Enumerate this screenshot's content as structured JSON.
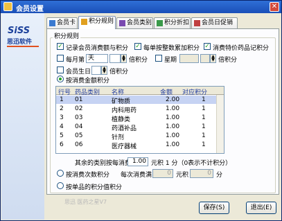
{
  "window": {
    "title": "会员设置",
    "close": "✕"
  },
  "logo": {
    "main": "SiSS",
    "sub": "思迅软件"
  },
  "tabs": [
    {
      "label": "会员卡"
    },
    {
      "label": "积分规则"
    },
    {
      "label": "会员类别"
    },
    {
      "label": "积分折扣"
    },
    {
      "label": "会员日促销"
    }
  ],
  "rules": {
    "group_label": "积分规则",
    "record_points": "记录会员消费额与积分",
    "whole_number": "每单按整数累加积分",
    "special_drug_points": "消费特价药品记积分",
    "monthly_prefix": "每月第",
    "monthly_unit": "天",
    "monthly_suffix": "倍积分",
    "weekly_prefix": "星期",
    "weekly_suffix": "倍积分",
    "birthday_prefix": "会员生日",
    "birthday_suffix": "倍积分",
    "by_amount": "按消费金额积分",
    "by_count": "按消费次数积分",
    "by_item": "按单品的积分值积分"
  },
  "grid": {
    "columns": [
      "行号",
      "药品类别",
      "名称",
      "金额",
      "对应积分"
    ],
    "rows": [
      {
        "no": "1",
        "code": "01",
        "name": "矿物质",
        "amount": "2.00",
        "points": "1"
      },
      {
        "no": "2",
        "code": "02",
        "name": "内科用药",
        "amount": "1.00",
        "points": "1"
      },
      {
        "no": "3",
        "code": "03",
        "name": "植静类",
        "amount": "1.00",
        "points": "1"
      },
      {
        "no": "4",
        "code": "04",
        "name": "药酒补品",
        "amount": "1.00",
        "points": "1"
      },
      {
        "no": "5",
        "code": "05",
        "name": "针剂",
        "amount": "1.00",
        "points": "1"
      },
      {
        "no": "6",
        "code": "06",
        "name": "医疗器械",
        "amount": "1.00",
        "points": "1"
      }
    ]
  },
  "other_category": {
    "label": "其余的类别按每消费",
    "value": "1.00",
    "unit_text": "元积 1 分（0表示不计积分）"
  },
  "count_rule": {
    "label": "每次消费满",
    "value": "0",
    "unit": "元积",
    "points": "0",
    "suffix": "分"
  },
  "watermark": "思迅 医药之星V7",
  "buttons": {
    "save": "保存(S)",
    "exit": "退出(E)"
  }
}
